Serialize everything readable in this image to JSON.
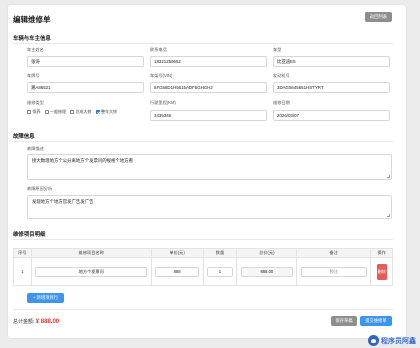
{
  "header": {
    "title": "编辑维修单",
    "back_label": "返回列表"
  },
  "owner_section": {
    "title": "车辆与车主信息",
    "owner_name": {
      "label": "车主姓名",
      "value": "张涛"
    },
    "phone": {
      "label": "联系电话",
      "value": "18321259652"
    },
    "model": {
      "label": "车型",
      "value": "比亚迪E5"
    },
    "plate": {
      "label": "车牌号",
      "value": "湘A86521"
    },
    "vin": {
      "label": "车架号(VIN)",
      "value": "5FG56D1H5615ADF5GHGHJ"
    },
    "engine": {
      "label": "发动机号",
      "value": "3DAG5645651HSTYRT"
    },
    "repair_type": {
      "label": "维修类型",
      "options": [
        {
          "label": "保养",
          "checked": false
        },
        {
          "label": "一般修理",
          "checked": false
        },
        {
          "label": "总成大修",
          "checked": false
        },
        {
          "label": "整车大修",
          "checked": true
        }
      ]
    },
    "mileage": {
      "label": "行驶里程(KM)",
      "value": "3435346"
    },
    "date": {
      "label": "维修日期",
      "value": "2026/03/07"
    }
  },
  "fault_section": {
    "title": "故障信息",
    "description": {
      "label": "故障描述",
      "value": "接大数理地方个公分离地方个发票问的规格个地方看"
    },
    "analysis": {
      "label": "故障原因分析",
      "value": "发现地方个地方官发广告发广告"
    }
  },
  "items_section": {
    "title": "维修项目明细",
    "columns": [
      "序号",
      "维修项目名称",
      "单价(元)",
      "数量",
      "总价(元)",
      "备注",
      "操作"
    ],
    "rows": [
      {
        "index": "1",
        "name": "地方个发票问",
        "price": "888",
        "qty": "1",
        "total": "888.00",
        "note": "预注",
        "action": "删除"
      }
    ],
    "add_label": "+ 新增项目行"
  },
  "footer": {
    "total_label": "总计金额:",
    "total_value": "¥ 888.00",
    "draft_label": "保存草稿",
    "submit_label": "提交维修单"
  },
  "watermark": {
    "text": "程序员阿鑫",
    "icon": "wechat-logo"
  },
  "colors": {
    "primary": "#3e95ef",
    "danger": "#e75b5b",
    "total": "#e53935",
    "muted_button": "#8e8e8e"
  }
}
